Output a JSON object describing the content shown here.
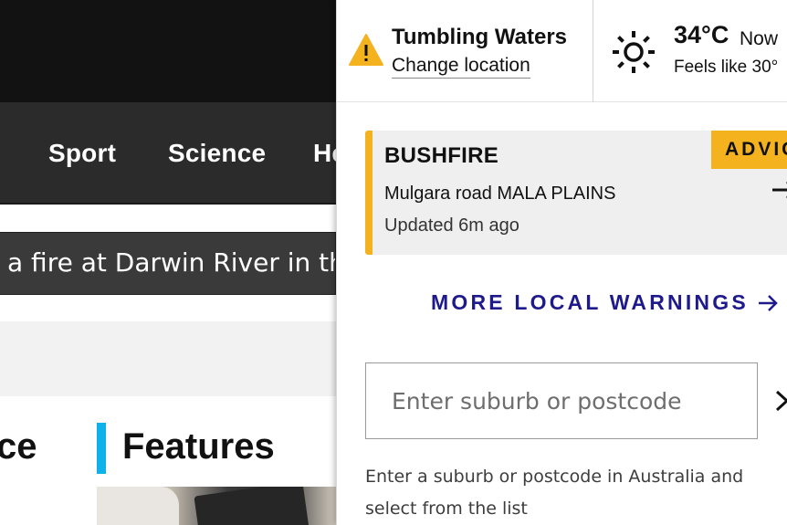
{
  "nav": {
    "items": [
      "Sport",
      "Science",
      "He"
    ]
  },
  "ticker": {
    "text": "a fire at Darwin River in th"
  },
  "sections": {
    "left_partial": "ce",
    "features_title": "Features",
    "features_accent_color": "#0fb2e8"
  },
  "location_panel": {
    "location_name": "Tumbling Waters",
    "change_location_label": "Change location",
    "warning_icon": "warning-triangle-icon",
    "weather": {
      "icon": "sun-icon",
      "temperature": "34°C",
      "now_label": "Now",
      "feels_like": "Feels like 30°"
    },
    "alert": {
      "type": "BUSHFIRE",
      "level": "ADVIC",
      "location": "Mulgara road MALA PLAINS",
      "updated": "Updated 6m ago",
      "accent_color": "#f5b21f"
    },
    "more_warnings_label": "MORE LOCAL WARNINGS",
    "more_warnings_color": "#1f1a8c",
    "search": {
      "placeholder": "Enter suburb or postcode",
      "value": ""
    },
    "helper_text": "Enter a suburb or postcode in Australia and select from the list"
  }
}
